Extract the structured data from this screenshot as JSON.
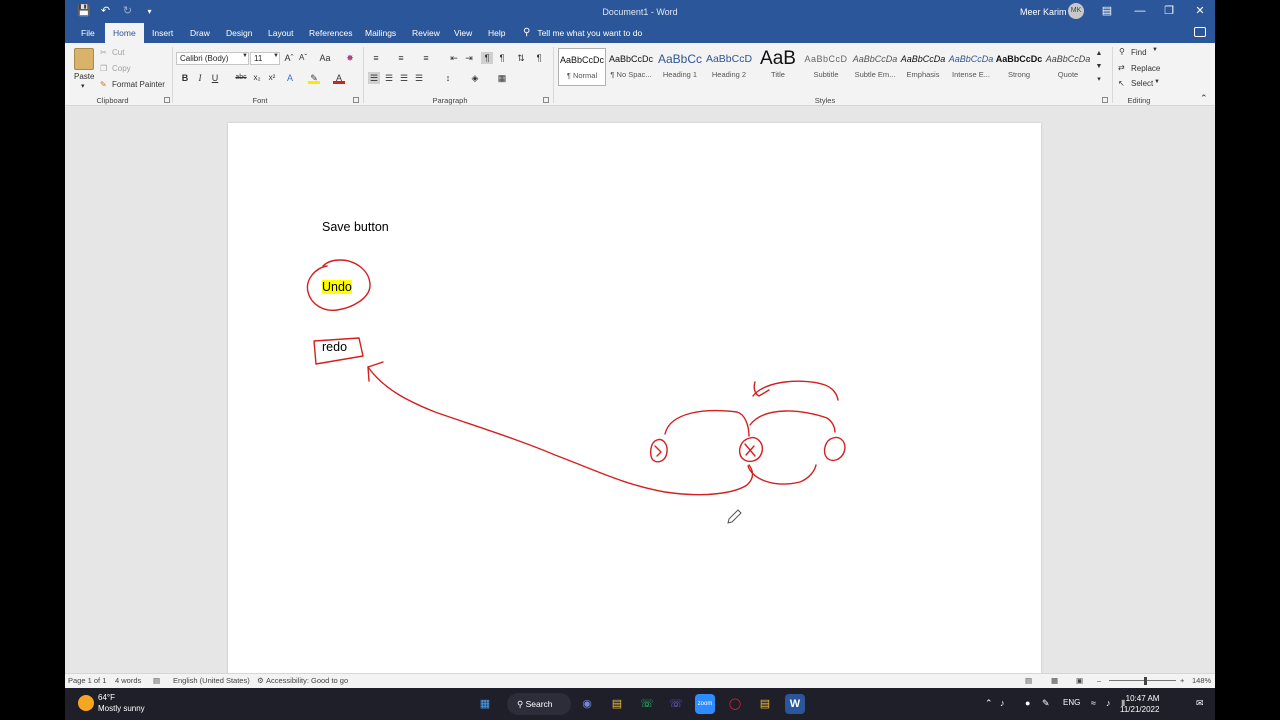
{
  "titlebar": {
    "doc_title": "Document1  -  Word",
    "user_name": "Meer Karim",
    "user_initials": "MK"
  },
  "tabs": [
    "File",
    "Home",
    "Insert",
    "Draw",
    "Design",
    "Layout",
    "References",
    "Mailings",
    "Review",
    "View",
    "Help"
  ],
  "tell_me": "Tell me what you want to do",
  "clipboard": {
    "paste": "Paste",
    "cut": "Cut",
    "copy": "Copy",
    "format_painter": "Format Painter",
    "label": "Clipboard"
  },
  "font": {
    "name": "Calibri (Body)",
    "size": "11",
    "label": "Font",
    "case": "Aa"
  },
  "paragraph": {
    "label": "Paragraph"
  },
  "styles": {
    "label": "Styles",
    "items": [
      {
        "sample": "AaBbCcDc",
        "name": "¶ Normal"
      },
      {
        "sample": "AaBbCcDc",
        "name": "¶ No Spac..."
      },
      {
        "sample": "AaBbCc",
        "name": "Heading 1"
      },
      {
        "sample": "AaBbCcD",
        "name": "Heading 2"
      },
      {
        "sample": "AaB",
        "name": "Title"
      },
      {
        "sample": "AaBbCcD",
        "name": "Subtitle"
      },
      {
        "sample": "AaBbCcDa",
        "name": "Subtle Em..."
      },
      {
        "sample": "AaBbCcDa",
        "name": "Emphasis"
      },
      {
        "sample": "AaBbCcDa",
        "name": "Intense E..."
      },
      {
        "sample": "AaBbCcDc",
        "name": "Strong"
      },
      {
        "sample": "AaBbCcDa",
        "name": "Quote"
      }
    ]
  },
  "editing": {
    "find": "Find",
    "replace": "Replace",
    "select": "Select",
    "label": "Editing"
  },
  "document": {
    "line1": "Save button",
    "line2": "Undo",
    "line3": "redo"
  },
  "status": {
    "page": "Page 1 of 1",
    "words": "4 words",
    "language": "English (United States)",
    "accessibility": "Accessibility: Good to go",
    "zoom": "148%"
  },
  "taskbar": {
    "temp": "64°F",
    "weather": "Mostly sunny",
    "search": "Search",
    "lang": "ENG",
    "time": "10:47 AM",
    "date": "11/21/2022"
  },
  "colors": {
    "word_blue": "#2b579a",
    "ink_red": "#d42020",
    "highlight": "#ffff00"
  }
}
